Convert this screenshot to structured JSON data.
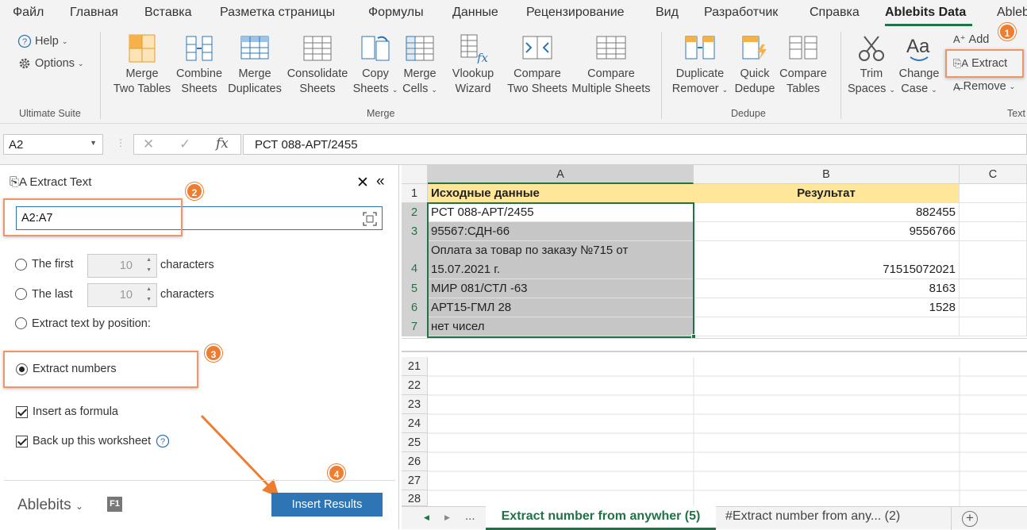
{
  "ribbon_tabs": [
    "Файл",
    "Главная",
    "Вставка",
    "Разметка страницы",
    "Формулы",
    "Данные",
    "Рецензирование",
    "Вид",
    "Разработчик",
    "Справка",
    "Ablebits Data",
    "Ableb"
  ],
  "ultimate": {
    "help": "Help",
    "options": "Options",
    "group": "Ultimate Suite"
  },
  "merge_buttons": [
    {
      "l1": "Merge",
      "l2": "Two Tables"
    },
    {
      "l1": "Combine",
      "l2": "Sheets"
    },
    {
      "l1": "Merge",
      "l2": "Duplicates"
    },
    {
      "l1": "Consolidate",
      "l2": "Sheets"
    },
    {
      "l1": "Copy",
      "l2": "Sheets"
    },
    {
      "l1": "Merge",
      "l2": "Cells"
    },
    {
      "l1": "Vlookup",
      "l2": "Wizard"
    },
    {
      "l1": "Compare",
      "l2": "Two Sheets"
    },
    {
      "l1": "Compare",
      "l2": "Multiple Sheets"
    }
  ],
  "merge_group": "Merge",
  "dedupe_buttons": [
    {
      "l1": "Duplicate",
      "l2": "Remover"
    },
    {
      "l1": "Quick",
      "l2": "Dedupe"
    },
    {
      "l1": "Compare",
      "l2": "Tables"
    }
  ],
  "dedupe_group": "Dedupe",
  "text_buttons": [
    {
      "l1": "Trim",
      "l2": "Spaces"
    },
    {
      "l1": "Change",
      "l2": "Case"
    }
  ],
  "text_small": {
    "add": "Add",
    "extract": "Extract",
    "remove": "Remove"
  },
  "text_group": "Text",
  "formula_bar": {
    "namebox": "A2",
    "formula": "РСТ 088-АРТ/2455",
    "fx": "fx"
  },
  "pane": {
    "title": "Extract Text",
    "range": "A2:A7",
    "first_label": "The first",
    "first_value": "10",
    "chars1": "characters",
    "last_label": "The last",
    "last_value": "10",
    "chars2": "characters",
    "by_position": "Extract text by position:",
    "numbers": "Extract numbers",
    "formula": "Insert as formula",
    "backup": "Back up this worksheet",
    "brand": "Ablebits",
    "f1": "F1",
    "insert": "Insert Results"
  },
  "badges": [
    "1",
    "2",
    "3",
    "4"
  ],
  "sheet": {
    "cols": [
      "A",
      "B",
      "C"
    ],
    "header": {
      "a": "Исходные данные",
      "b": "Результат"
    },
    "rows": [
      {
        "n": "1"
      },
      {
        "n": "2",
        "a": "РСТ 088-АРТ/2455",
        "b": "882455"
      },
      {
        "n": "3",
        "a": "95567:СДН-66",
        "b": "9556766"
      },
      {
        "n": "4",
        "a1": "Оплата за товар по заказу №715 от",
        "a2": "15.07.2021 г.",
        "b": "71515072021"
      },
      {
        "n": "5",
        "a": "МИР 081/СТЛ -63",
        "b": "8163"
      },
      {
        "n": "6",
        "a": "АРТ15-ГМЛ 28",
        "b": "1528"
      },
      {
        "n": "7",
        "a": "нет чисел",
        "b": ""
      }
    ],
    "lower_rows": [
      "21",
      "22",
      "23",
      "24",
      "25",
      "26",
      "27",
      "28"
    ]
  },
  "sheet_tabs": {
    "more": "...",
    "active": "Extract number from anywher (5)",
    "other": "#Extract number from any... (2)",
    "add": "+"
  },
  "colors": {
    "accent": "#217346",
    "orange": "#ed7d31",
    "blue": "#2e75b6",
    "header_fill": "#ffe699",
    "selection": "#c6c6c6"
  }
}
